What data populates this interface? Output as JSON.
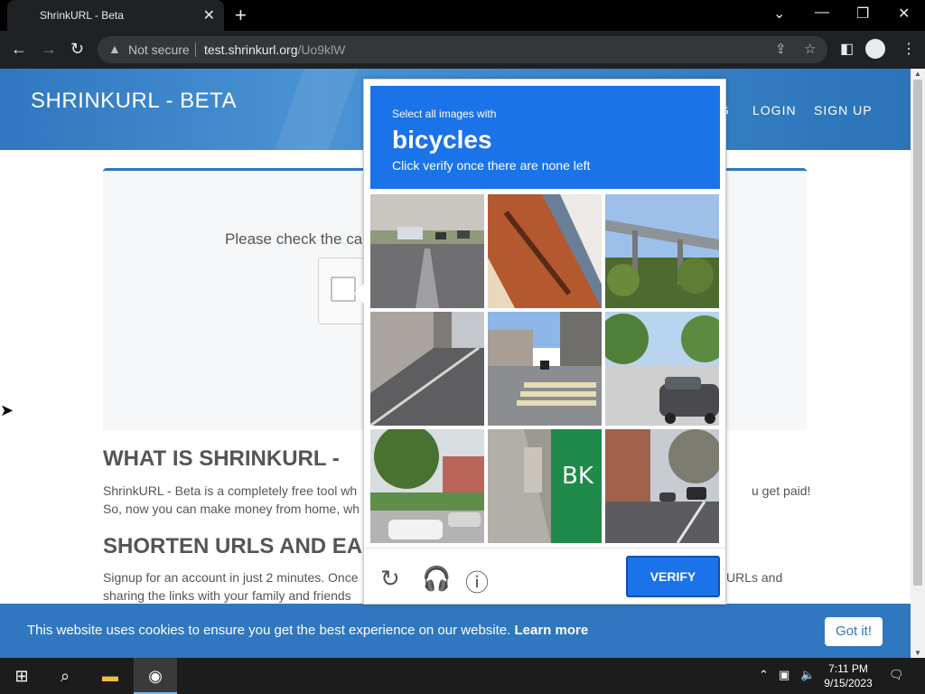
{
  "browser": {
    "tab_title": "ShrinkURL - Beta",
    "security_label": "Not secure",
    "url_host": "test.shrinkurl.org",
    "url_path": "/Uo9klW"
  },
  "site": {
    "brand": "SHRINKURL - BETA",
    "nav": [
      "G",
      "LOGIN",
      "SIGN UP"
    ],
    "card_text": "Please check the ca",
    "h2_1": "WHAT IS SHRINKURL -",
    "p1_line1": "ShrinkURL - Beta is a completely free tool wh",
    "p1_line1_right": "u get paid!",
    "p1_line2": "So, now you can make money from home, wh",
    "h2_2": "SHORTEN URLS AND EA",
    "p2_line1": "Signup for an account in just 2 minutes. Once",
    "p2_line1_right": "URLs and",
    "p2_line2": "sharing the links with your family and friends"
  },
  "cookie": {
    "text": "This website uses cookies to ensure you get the best experience on our website.",
    "link": "Learn more",
    "button": "Got it!"
  },
  "captcha": {
    "instruction_small": "Select all images with",
    "target": "bicycles",
    "instruction_sub": "Click verify once there are none left",
    "verify": "VERIFY",
    "tiles": [
      "street-road",
      "building-eaves",
      "bridge-trees",
      "sidewalk-wall",
      "crosswalk-street",
      "parked-cars-street",
      "street-corner-trees",
      "sidewalk-green-sign",
      "city-street-cars"
    ]
  },
  "taskbar": {
    "time": "7:11 PM",
    "date": "9/15/2023"
  },
  "colors": {
    "brand_blue": "#2f77bf",
    "captcha_blue": "#1a73e8"
  }
}
